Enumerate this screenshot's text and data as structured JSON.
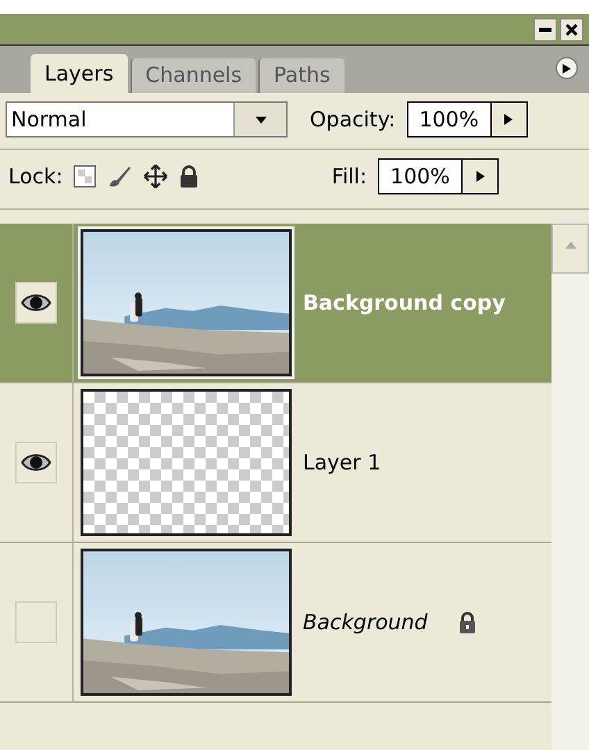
{
  "tabs": [
    {
      "label": "Layers",
      "selected": true
    },
    {
      "label": "Channels",
      "selected": false
    },
    {
      "label": "Paths",
      "selected": false
    }
  ],
  "blend_mode": {
    "value": "Normal"
  },
  "opacity": {
    "label": "Opacity:",
    "value": "100%"
  },
  "lock": {
    "label": "Lock:"
  },
  "fill": {
    "label": "Fill:",
    "value": "100%"
  },
  "layers": [
    {
      "name": "Background copy",
      "visible": true,
      "selected": true,
      "locked": false,
      "kind": "picture"
    },
    {
      "name": "Layer 1",
      "visible": true,
      "selected": false,
      "locked": false,
      "kind": "transparent"
    },
    {
      "name": "Background",
      "visible": false,
      "selected": false,
      "locked": true,
      "kind": "picture"
    }
  ]
}
